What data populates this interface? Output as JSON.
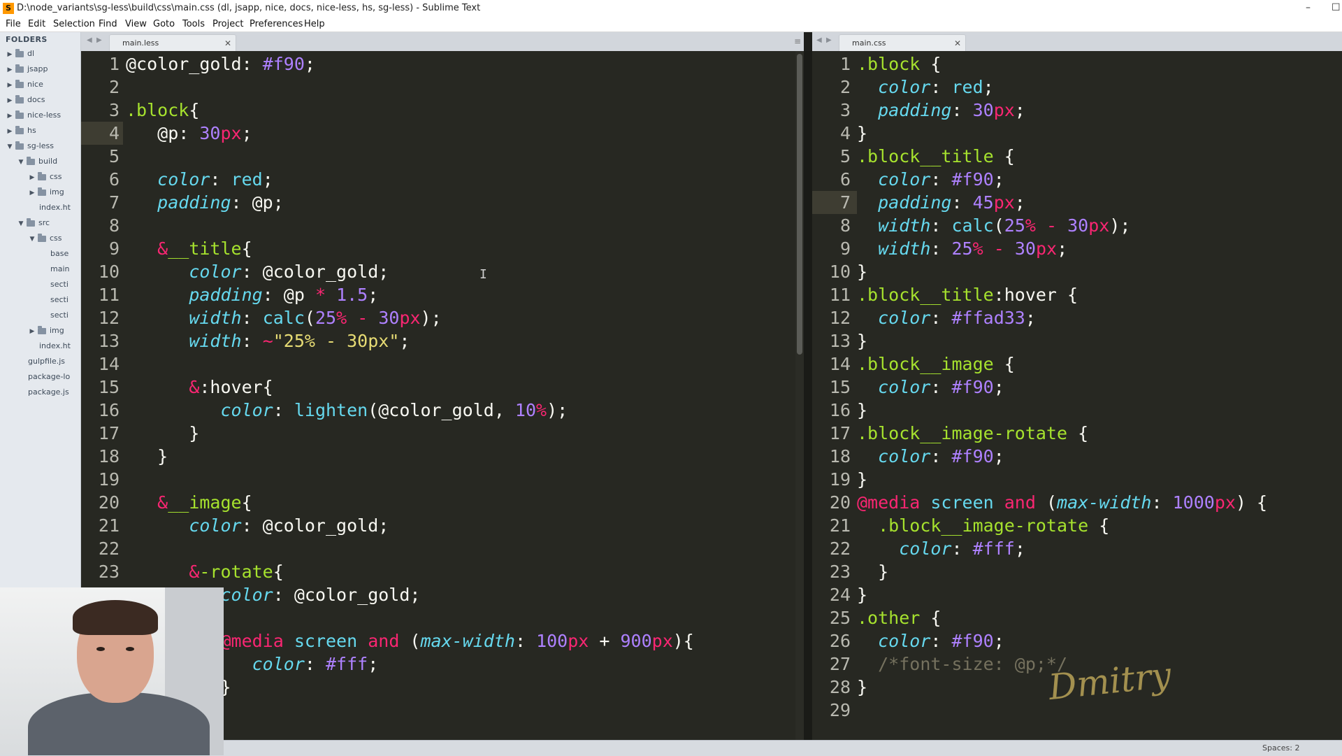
{
  "window": {
    "title": "D:\\node_variants\\sg-less\\build\\css\\main.css (dl, jsapp, nice, docs, nice-less, hs, sg-less) - Sublime Text",
    "app_icon": "sublime-logo-icon",
    "minimize_glyph": "–",
    "extra_glyph": "☐"
  },
  "menu": [
    "File",
    "Edit",
    "Selection",
    "Find",
    "View",
    "Goto",
    "Tools",
    "Project",
    "Preferences",
    "Help"
  ],
  "sidebar": {
    "header": "FOLDERS",
    "items": [
      {
        "label": "dl",
        "depth": 0,
        "type": "folder",
        "expanded": false
      },
      {
        "label": "jsapp",
        "depth": 0,
        "type": "folder",
        "expanded": false
      },
      {
        "label": "nice",
        "depth": 0,
        "type": "folder",
        "expanded": false
      },
      {
        "label": "docs",
        "depth": 0,
        "type": "folder",
        "expanded": false
      },
      {
        "label": "nice-less",
        "depth": 0,
        "type": "folder",
        "expanded": false
      },
      {
        "label": "hs",
        "depth": 0,
        "type": "folder",
        "expanded": false
      },
      {
        "label": "sg-less",
        "depth": 0,
        "type": "folder",
        "expanded": true
      },
      {
        "label": "build",
        "depth": 1,
        "type": "folder",
        "expanded": true
      },
      {
        "label": "css",
        "depth": 2,
        "type": "folder",
        "expanded": false
      },
      {
        "label": "img",
        "depth": 2,
        "type": "folder",
        "expanded": false
      },
      {
        "label": "index.ht",
        "depth": 3,
        "type": "file"
      },
      {
        "label": "src",
        "depth": 1,
        "type": "folder",
        "expanded": true
      },
      {
        "label": "css",
        "depth": 2,
        "type": "folder",
        "expanded": true
      },
      {
        "label": "base",
        "depth": 4,
        "type": "file"
      },
      {
        "label": "main",
        "depth": 4,
        "type": "file"
      },
      {
        "label": "secti",
        "depth": 4,
        "type": "file"
      },
      {
        "label": "secti",
        "depth": 4,
        "type": "file"
      },
      {
        "label": "secti",
        "depth": 4,
        "type": "file"
      },
      {
        "label": "img",
        "depth": 2,
        "type": "folder",
        "expanded": false
      },
      {
        "label": "index.ht",
        "depth": 3,
        "type": "file"
      },
      {
        "label": "gulpfile.js",
        "depth": 2,
        "type": "file"
      },
      {
        "label": "package-lo",
        "depth": 2,
        "type": "file"
      },
      {
        "label": "package.js",
        "depth": 2,
        "type": "file"
      }
    ]
  },
  "left_pane": {
    "tab_label": "main.less",
    "current_line": 4,
    "lines": [
      [
        [
          "t-var",
          "@color_gold"
        ],
        [
          "t-plain",
          ": "
        ],
        [
          "t-num",
          "#f90"
        ],
        [
          "t-plain",
          ";"
        ]
      ],
      [],
      [
        [
          "t-sel",
          ".block"
        ],
        [
          "t-plain",
          "{"
        ]
      ],
      [
        [
          "t-plain",
          "   "
        ],
        [
          "t-var",
          "@p"
        ],
        [
          "t-plain",
          ": "
        ],
        [
          "t-num",
          "30"
        ],
        [
          "t-unit",
          "px"
        ],
        [
          "t-plain",
          ";"
        ]
      ],
      [],
      [
        [
          "t-plain",
          "   "
        ],
        [
          "t-prop",
          "color"
        ],
        [
          "t-plain",
          ": "
        ],
        [
          "t-val",
          "red"
        ],
        [
          "t-plain",
          ";"
        ]
      ],
      [
        [
          "t-plain",
          "   "
        ],
        [
          "t-prop",
          "padding"
        ],
        [
          "t-plain",
          ": @p;"
        ]
      ],
      [],
      [
        [
          "t-plain",
          "   "
        ],
        [
          "t-amp",
          "&"
        ],
        [
          "t-sel",
          "__title"
        ],
        [
          "t-plain",
          "{"
        ]
      ],
      [
        [
          "t-plain",
          "      "
        ],
        [
          "t-prop",
          "color"
        ],
        [
          "t-plain",
          ": @color_gold;"
        ]
      ],
      [
        [
          "t-plain",
          "      "
        ],
        [
          "t-prop",
          "padding"
        ],
        [
          "t-plain",
          ": @p "
        ],
        [
          "t-op",
          "*"
        ],
        [
          "t-plain",
          " "
        ],
        [
          "t-num",
          "1.5"
        ],
        [
          "t-plain",
          ";"
        ]
      ],
      [
        [
          "t-plain",
          "      "
        ],
        [
          "t-prop",
          "width"
        ],
        [
          "t-plain",
          ": "
        ],
        [
          "t-fn",
          "calc"
        ],
        [
          "t-plain",
          "("
        ],
        [
          "t-num",
          "25"
        ],
        [
          "t-unit",
          "%"
        ],
        [
          "t-plain",
          " "
        ],
        [
          "t-op",
          "-"
        ],
        [
          "t-plain",
          " "
        ],
        [
          "t-num",
          "30"
        ],
        [
          "t-unit",
          "px"
        ],
        [
          "t-plain",
          ");"
        ]
      ],
      [
        [
          "t-plain",
          "      "
        ],
        [
          "t-prop",
          "width"
        ],
        [
          "t-plain",
          ": "
        ],
        [
          "t-op",
          "~"
        ],
        [
          "t-str",
          "\"25% - 30px\""
        ],
        [
          "t-plain",
          ";"
        ]
      ],
      [],
      [
        [
          "t-plain",
          "      "
        ],
        [
          "t-amp",
          "&"
        ],
        [
          "t-plain",
          ":hover{"
        ]
      ],
      [
        [
          "t-plain",
          "         "
        ],
        [
          "t-prop",
          "color"
        ],
        [
          "t-plain",
          ": "
        ],
        [
          "t-fn",
          "lighten"
        ],
        [
          "t-plain",
          "(@color_gold, "
        ],
        [
          "t-num",
          "10"
        ],
        [
          "t-unit",
          "%"
        ],
        [
          "t-plain",
          ");"
        ]
      ],
      [
        [
          "t-plain",
          "      }"
        ]
      ],
      [
        [
          "t-plain",
          "   }"
        ]
      ],
      [],
      [
        [
          "t-plain",
          "   "
        ],
        [
          "t-amp",
          "&"
        ],
        [
          "t-sel",
          "__image"
        ],
        [
          "t-plain",
          "{"
        ]
      ],
      [
        [
          "t-plain",
          "      "
        ],
        [
          "t-prop",
          "color"
        ],
        [
          "t-plain",
          ": @color_gold;"
        ]
      ],
      [],
      [
        [
          "t-plain",
          "      "
        ],
        [
          "t-amp",
          "&"
        ],
        [
          "t-sel",
          "-rotate"
        ],
        [
          "t-plain",
          "{"
        ]
      ],
      [
        [
          "t-plain",
          "         "
        ],
        [
          "t-prop",
          "color"
        ],
        [
          "t-plain",
          ": @color_gold;"
        ]
      ],
      [],
      [
        [
          "t-plain",
          "         "
        ],
        [
          "t-kw",
          "@media"
        ],
        [
          "t-plain",
          " "
        ],
        [
          "t-val",
          "screen"
        ],
        [
          "t-plain",
          " "
        ],
        [
          "t-kw",
          "and"
        ],
        [
          "t-plain",
          " ("
        ],
        [
          "t-prop",
          "max-width"
        ],
        [
          "t-plain",
          ": "
        ],
        [
          "t-num",
          "100"
        ],
        [
          "t-unit",
          "px"
        ],
        [
          "t-plain",
          " + "
        ],
        [
          "t-num",
          "900"
        ],
        [
          "t-unit",
          "px"
        ],
        [
          "t-plain",
          "){"
        ]
      ],
      [
        [
          "t-plain",
          "            "
        ],
        [
          "t-prop",
          "color"
        ],
        [
          "t-plain",
          ": "
        ],
        [
          "t-num",
          "#fff"
        ],
        [
          "t-plain",
          ";"
        ]
      ],
      [
        [
          "t-plain",
          "         }"
        ]
      ]
    ]
  },
  "right_pane": {
    "tab_label": "main.css",
    "current_line": 7,
    "lines": [
      [
        [
          "t-sel",
          ".block"
        ],
        [
          "t-plain",
          " {"
        ]
      ],
      [
        [
          "t-plain",
          "  "
        ],
        [
          "t-prop",
          "color"
        ],
        [
          "t-plain",
          ": "
        ],
        [
          "t-val",
          "red"
        ],
        [
          "t-plain",
          ";"
        ]
      ],
      [
        [
          "t-plain",
          "  "
        ],
        [
          "t-prop",
          "padding"
        ],
        [
          "t-plain",
          ": "
        ],
        [
          "t-num",
          "30"
        ],
        [
          "t-unit",
          "px"
        ],
        [
          "t-plain",
          ";"
        ]
      ],
      [
        [
          "t-plain",
          "}"
        ]
      ],
      [
        [
          "t-sel",
          ".block__title"
        ],
        [
          "t-plain",
          " {"
        ]
      ],
      [
        [
          "t-plain",
          "  "
        ],
        [
          "t-prop",
          "color"
        ],
        [
          "t-plain",
          ": "
        ],
        [
          "t-num",
          "#f90"
        ],
        [
          "t-plain",
          ";"
        ]
      ],
      [
        [
          "t-plain",
          "  "
        ],
        [
          "t-prop",
          "padding"
        ],
        [
          "t-plain",
          ": "
        ],
        [
          "t-num",
          "45"
        ],
        [
          "t-unit",
          "px"
        ],
        [
          "t-plain",
          ";"
        ]
      ],
      [
        [
          "t-plain",
          "  "
        ],
        [
          "t-prop",
          "width"
        ],
        [
          "t-plain",
          ": "
        ],
        [
          "t-fn",
          "calc"
        ],
        [
          "t-plain",
          "("
        ],
        [
          "t-num",
          "25"
        ],
        [
          "t-unit",
          "%"
        ],
        [
          "t-plain",
          " "
        ],
        [
          "t-op",
          "-"
        ],
        [
          "t-plain",
          " "
        ],
        [
          "t-num",
          "30"
        ],
        [
          "t-unit",
          "px"
        ],
        [
          "t-plain",
          ");"
        ]
      ],
      [
        [
          "t-plain",
          "  "
        ],
        [
          "t-prop",
          "width"
        ],
        [
          "t-plain",
          ": "
        ],
        [
          "t-num",
          "25"
        ],
        [
          "t-unit",
          "%"
        ],
        [
          "t-plain",
          " "
        ],
        [
          "t-op",
          "-"
        ],
        [
          "t-plain",
          " "
        ],
        [
          "t-num",
          "30"
        ],
        [
          "t-unit",
          "px"
        ],
        [
          "t-plain",
          ";"
        ]
      ],
      [
        [
          "t-plain",
          "}"
        ]
      ],
      [
        [
          "t-sel",
          ".block__title"
        ],
        [
          "t-plain",
          ":hover {"
        ]
      ],
      [
        [
          "t-plain",
          "  "
        ],
        [
          "t-prop",
          "color"
        ],
        [
          "t-plain",
          ": "
        ],
        [
          "t-num",
          "#ffad33"
        ],
        [
          "t-plain",
          ";"
        ]
      ],
      [
        [
          "t-plain",
          "}"
        ]
      ],
      [
        [
          "t-sel",
          ".block__image"
        ],
        [
          "t-plain",
          " {"
        ]
      ],
      [
        [
          "t-plain",
          "  "
        ],
        [
          "t-prop",
          "color"
        ],
        [
          "t-plain",
          ": "
        ],
        [
          "t-num",
          "#f90"
        ],
        [
          "t-plain",
          ";"
        ]
      ],
      [
        [
          "t-plain",
          "}"
        ]
      ],
      [
        [
          "t-sel",
          ".block__image-rotate"
        ],
        [
          "t-plain",
          " {"
        ]
      ],
      [
        [
          "t-plain",
          "  "
        ],
        [
          "t-prop",
          "color"
        ],
        [
          "t-plain",
          ": "
        ],
        [
          "t-num",
          "#f90"
        ],
        [
          "t-plain",
          ";"
        ]
      ],
      [
        [
          "t-plain",
          "}"
        ]
      ],
      [
        [
          "t-kw",
          "@media"
        ],
        [
          "t-plain",
          " "
        ],
        [
          "t-val",
          "screen"
        ],
        [
          "t-plain",
          " "
        ],
        [
          "t-kw",
          "and"
        ],
        [
          "t-plain",
          " ("
        ],
        [
          "t-prop",
          "max-width"
        ],
        [
          "t-plain",
          ": "
        ],
        [
          "t-num",
          "1000"
        ],
        [
          "t-unit",
          "px"
        ],
        [
          "t-plain",
          ") {"
        ]
      ],
      [
        [
          "t-plain",
          "  "
        ],
        [
          "t-sel",
          ".block__image-rotate"
        ],
        [
          "t-plain",
          " {"
        ]
      ],
      [
        [
          "t-plain",
          "    "
        ],
        [
          "t-prop",
          "color"
        ],
        [
          "t-plain",
          ": "
        ],
        [
          "t-num",
          "#fff"
        ],
        [
          "t-plain",
          ";"
        ]
      ],
      [
        [
          "t-plain",
          "  }"
        ]
      ],
      [
        [
          "t-plain",
          "}"
        ]
      ],
      [
        [
          "t-sel",
          ".other"
        ],
        [
          "t-plain",
          " {"
        ]
      ],
      [
        [
          "t-plain",
          "  "
        ],
        [
          "t-prop",
          "color"
        ],
        [
          "t-plain",
          ": "
        ],
        [
          "t-num",
          "#f90"
        ],
        [
          "t-plain",
          ";"
        ]
      ],
      [
        [
          "t-plain",
          "  "
        ],
        [
          "t-com",
          "/*font-size: @p;*/"
        ]
      ],
      [
        [
          "t-plain",
          "}"
        ]
      ],
      []
    ]
  },
  "status": {
    "spaces": "Spaces: 2"
  },
  "overlay": {
    "signature": "Dmitry",
    "webcam": "presenter-webcam"
  },
  "colors": {
    "editor_bg": "#272822",
    "sidebar_bg": "#e5e9ee",
    "accent_gold": "#ff9900"
  }
}
